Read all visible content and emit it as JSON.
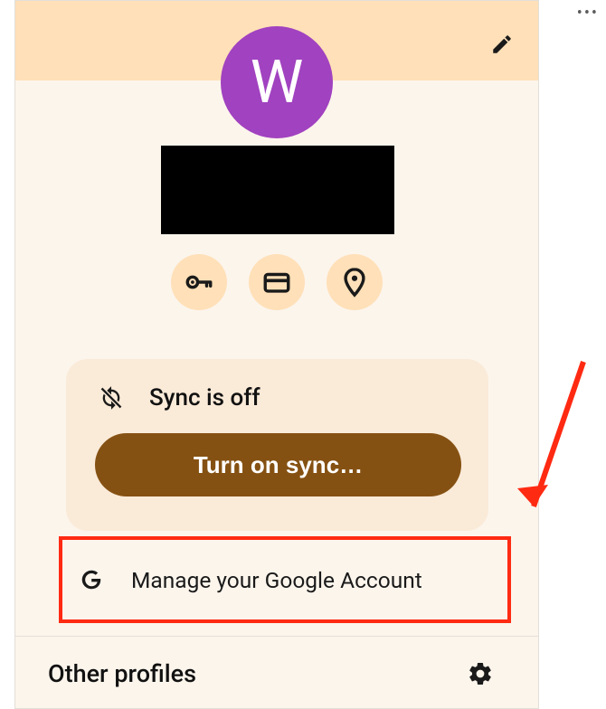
{
  "profile": {
    "avatar_letter": "W",
    "avatar_color": "#a142c0",
    "name_redacted": true
  },
  "banner": {
    "edit_aria": "Edit profile"
  },
  "shortcuts": {
    "passwords_aria": "Passwords",
    "payments_aria": "Payment methods",
    "addresses_aria": "Addresses"
  },
  "sync": {
    "status_label": "Sync is off",
    "turn_on_label": "Turn on sync…"
  },
  "manage": {
    "label": "Manage your Google Account"
  },
  "other_profiles": {
    "label": "Other profiles",
    "settings_aria": "Manage profiles"
  },
  "overflow": {
    "dots": "•••"
  }
}
